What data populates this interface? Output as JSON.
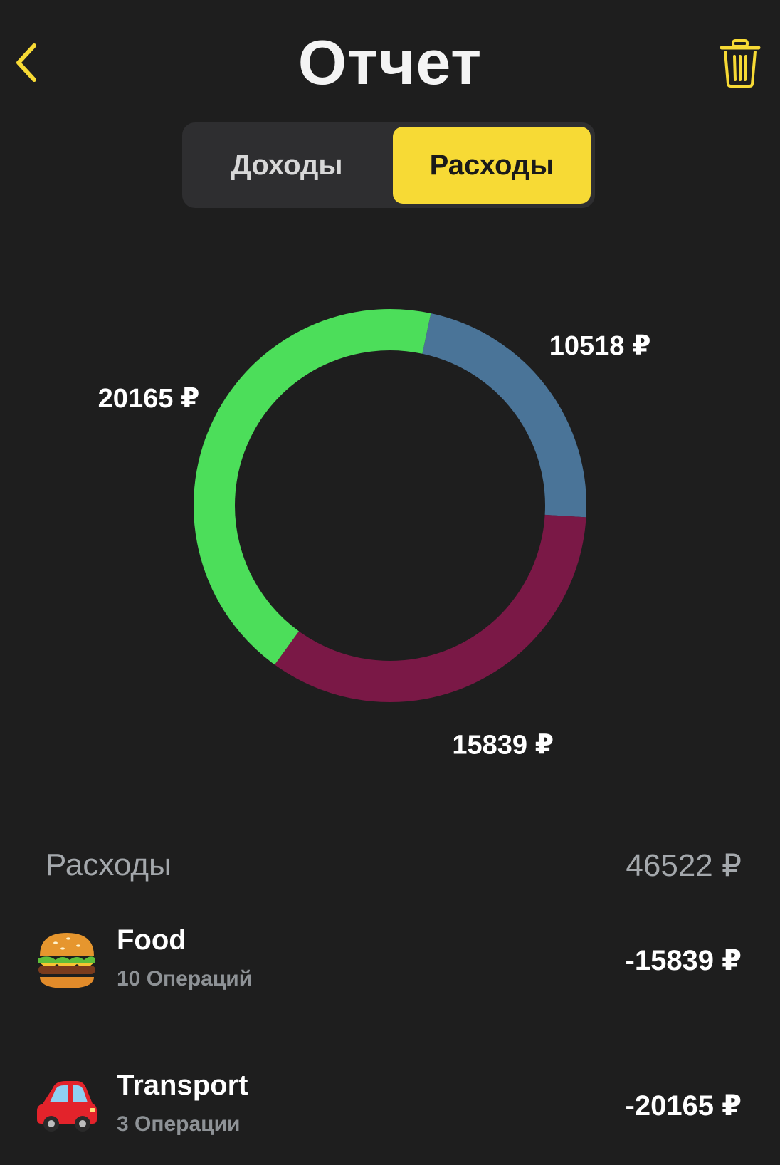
{
  "header": {
    "title": "Отчет"
  },
  "tabs": {
    "income_label": "Доходы",
    "expense_label": "Расходы",
    "selected": "Расходы"
  },
  "colors": {
    "accent": "#f7da35",
    "background": "#1e1e1e",
    "transport": "#4cde5a",
    "other": "#4a7498",
    "food": "#7a1846"
  },
  "chart_data": {
    "type": "pie",
    "series": [
      {
        "value": 10518,
        "label": "10518 ₽",
        "color": "#4a7498"
      },
      {
        "value": 15839,
        "label": "15839 ₽",
        "color": "#7a1846"
      },
      {
        "value": 20165,
        "label": "20165 ₽",
        "color": "#4cde5a"
      }
    ]
  },
  "summary": {
    "label": "Расходы",
    "total": "46522 ₽"
  },
  "categories": [
    {
      "icon": "burger-icon",
      "name": "Food",
      "operations": "10 Операций",
      "amount": "-15839 ₽"
    },
    {
      "icon": "car-icon",
      "name": "Transport",
      "operations": "3 Операции",
      "amount": "-20165 ₽"
    }
  ]
}
